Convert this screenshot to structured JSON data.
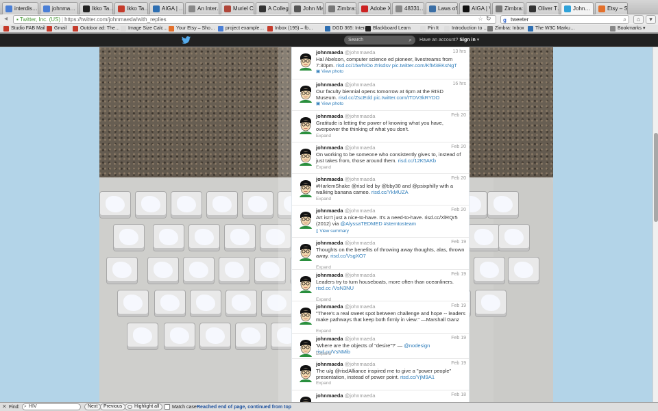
{
  "browser": {
    "tabs": [
      {
        "label": "interdis…",
        "icon": "google-icon",
        "color": "#4a7fd6"
      },
      {
        "label": "johnma…",
        "icon": "google-icon",
        "color": "#4a7fd6"
      },
      {
        "label": "Ikko Ta…",
        "icon": "blog-icon",
        "color": "#222222"
      },
      {
        "label": "Ikko Ta…",
        "icon": "adobe-icon",
        "color": "#c53b2b"
      },
      {
        "label": "AIGA | …",
        "icon": "aiga-icon",
        "color": "#2e6fb2"
      },
      {
        "label": "An Inter…",
        "icon": "page-icon",
        "color": "#888888"
      },
      {
        "label": "Muriel C…",
        "icon": "page-icon",
        "color": "#b0463a"
      },
      {
        "label": "A Colleg…",
        "icon": "page-icon",
        "color": "#333333"
      },
      {
        "label": "John Ma…",
        "icon": "page-icon",
        "color": "#555555"
      },
      {
        "label": "Zimbra:…",
        "icon": "zimbra-icon",
        "color": "#777777"
      },
      {
        "label": "Adobe X…",
        "icon": "youtube-icon",
        "color": "#cc2222"
      },
      {
        "label": "48331…",
        "icon": "page-icon",
        "color": "#888888"
      },
      {
        "label": "Laws of…",
        "icon": "wordpress-icon",
        "color": "#3a6ea5"
      },
      {
        "label": "AIGA | V…",
        "icon": "aiga-icon",
        "color": "#111111"
      },
      {
        "label": "Zimbra:…",
        "icon": "zimbra-icon",
        "color": "#777777"
      },
      {
        "label": "Oliver T…",
        "icon": "page-icon",
        "color": "#333333"
      },
      {
        "label": "John…",
        "icon": "twitter-icon",
        "color": "#2fa2d9"
      },
      {
        "label": "Etsy – S…",
        "icon": "etsy-icon",
        "color": "#e3702b"
      }
    ],
    "address": {
      "site": "Twitter, Inc. (US)",
      "url": "https://twitter.com/johnmaeda/with_replies"
    },
    "web_search": {
      "value": "tweeter"
    },
    "bookmarks": [
      {
        "label": "Studio FAB Mail",
        "color": "#c53b2b"
      },
      {
        "label": "Gmail",
        "color": "#c53b2b"
      },
      {
        "label": "Outdoor ad: The…",
        "color": "#c53b2b"
      },
      {
        "label": "Image Size Calc…",
        "color": "#dddddd"
      },
      {
        "label": "Your Etsy – Sho…",
        "color": "#e3702b"
      },
      {
        "label": "project example…",
        "color": "#4a7fd6"
      },
      {
        "label": "Inbox (195) – fb…",
        "color": "#c53b2b"
      },
      {
        "label": "DGD 365: Intera…",
        "color": "#2e6fb2"
      },
      {
        "label": "Blackboard Learn",
        "color": "#222222"
      },
      {
        "label": "Pin It",
        "color": "#dddddd"
      },
      {
        "label": "Introduction to …",
        "color": "#dddddd"
      },
      {
        "label": "Zimbra: Inbox",
        "color": "#777777"
      },
      {
        "label": "The W3C Marku…",
        "color": "#2e6fb2"
      }
    ],
    "bookmarks_menu": "Bookmarks"
  },
  "twitter": {
    "search_placeholder": "Search",
    "signin_prompt": "Have an account?",
    "signin_label": "Sign in"
  },
  "tweets": [
    {
      "name": "johnmaeda",
      "handle": "@johnmaeda",
      "time": "13 hrs",
      "text": "Hal Abelson, computer science ed pioneer, livestreams from 7:30pm.",
      "links": "risd.cc/15whIOo #risdsv pic.twitter.com/KfM3EKsNgT",
      "action": "View photo",
      "action_type": "photo"
    },
    {
      "name": "johnmaeda",
      "handle": "@johnmaeda",
      "time": "16 hrs",
      "text": "Our faculty biennial opens tomorrow at 6pm at the RISD Museum.",
      "links": "risd.cc/ZscEdd pic.twitter.com/tTDV3kRYDO",
      "action": "View photo",
      "action_type": "photo"
    },
    {
      "name": "johnmaeda",
      "handle": "@johnmaeda",
      "time": "Feb 20",
      "text": "Gratitude is letting the power of knowing what you have, overpower the thinking of what you don't.",
      "links": "",
      "action": "Expand",
      "action_type": "expand"
    },
    {
      "name": "johnmaeda",
      "handle": "@johnmaeda",
      "time": "Feb 20",
      "text": "On working to be someone who consistently gives to, instead of just takes from, those around them.",
      "links": "risd.cc/12K5AKb",
      "action": "Expand",
      "action_type": "expand"
    },
    {
      "name": "johnmaeda",
      "handle": "@johnmaeda",
      "time": "Feb 20",
      "text": "#HarlemShake @risd led by @bby30 and @psixphilly with a walking banana cameo.",
      "links": "risd.cc/YkMUZA",
      "action": "Expand",
      "action_type": "expand"
    },
    {
      "name": "johnmaeda",
      "handle": "@johnmaeda",
      "time": "Feb 20",
      "text": "Art isn't just a nice-to-have. It's a need-to-have. risd.cc/XlRQr5 (2012) via",
      "links": "@AlyssaTEDMED #stemtosteam",
      "action": "View summary",
      "action_type": "summary"
    },
    {
      "name": "johnmaeda",
      "handle": "@johnmaeda",
      "time": "Feb 19",
      "text": "Thoughts on the benefits of throwing away thoughts, alas, thrown away.",
      "links": "risd.cc/VsgXO7",
      "action": "Expand",
      "action_type": "expand"
    },
    {
      "name": "johnmaeda",
      "handle": "@johnmaeda",
      "time": "Feb 19",
      "text": "Leaders try to turn houseboats, more often than oceanliners.",
      "links": "risd.cc /VsN3NU",
      "action": "Expand",
      "action_type": "expand"
    },
    {
      "name": "johnmaeda",
      "handle": "@johnmaeda",
      "time": "Feb 19",
      "text": "\"There's a real sweet spot between challenge and hope -- leaders make pathways that keep both firmly in view.\" —Marshall Ganz",
      "links": "",
      "action": "Expand",
      "action_type": "expand"
    },
    {
      "name": "johnmaeda",
      "handle": "@johnmaeda",
      "time": "Feb 19",
      "text": "'Where are the objects of \"desire\"?' —",
      "links": "@nodesign risd.cc/VsNMib",
      "action": "Expand",
      "action_type": "expand"
    },
    {
      "name": "johnmaeda",
      "handle": "@johnmaeda",
      "time": "Feb 19",
      "text": "The u/g @risdAlliance inspired me to give a \"power people\" presentation, instead of power point.",
      "links": "risd.cc/YjM9A1",
      "action": "Expand",
      "action_type": "expand"
    },
    {
      "name": "johnmaeda",
      "handle": "@johnmaeda",
      "time": "Feb 18",
      "text": "",
      "links": "",
      "action": "",
      "action_type": "none"
    }
  ],
  "findbar": {
    "label": "Find:",
    "query": "HIV",
    "next": "Next",
    "previous": "Previous",
    "highlight_all": "Highlight all",
    "match_case": "Match case",
    "status": "Reached end of page, continued from top"
  },
  "colors": {
    "twitter_blue": "#2b7bb9",
    "page_bg": "#b3d4e8",
    "topbar": "#212121"
  }
}
